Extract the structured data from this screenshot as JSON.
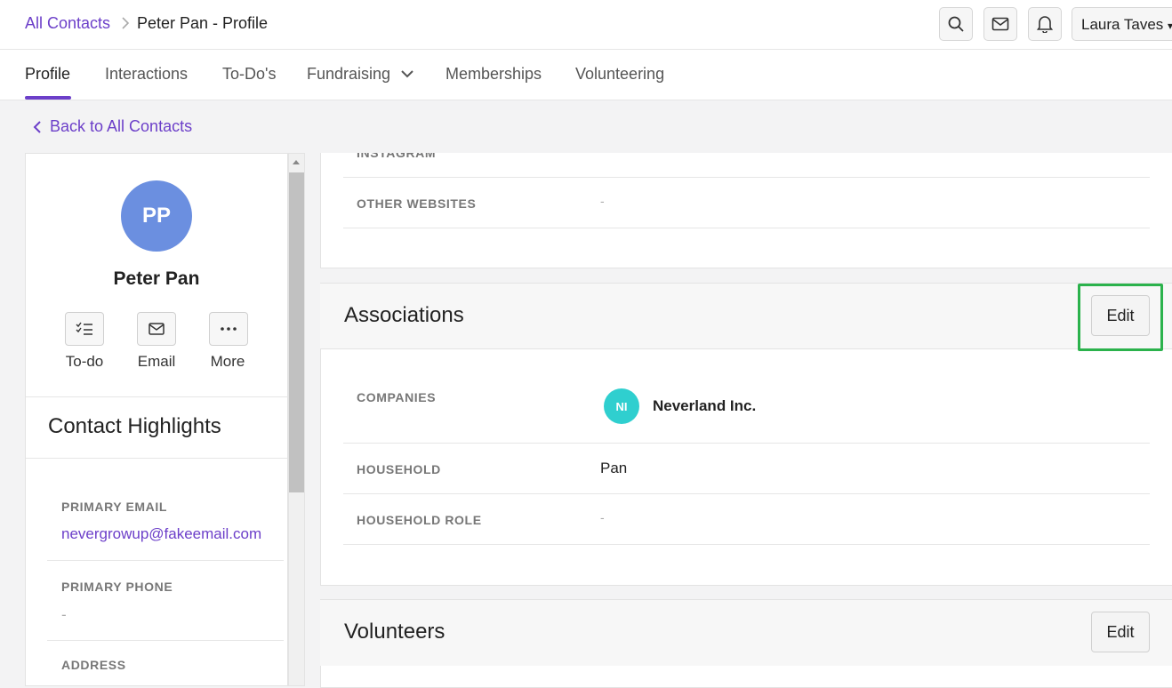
{
  "breadcrumb": {
    "link": "All Contacts",
    "current": "Peter Pan - Profile"
  },
  "header": {
    "user_name": "Laura Taves"
  },
  "tabs": [
    {
      "label": "Profile"
    },
    {
      "label": "Interactions"
    },
    {
      "label": "To-Do's"
    },
    {
      "label": "Fundraising"
    },
    {
      "label": "Memberships"
    },
    {
      "label": "Volunteering"
    }
  ],
  "back_link": "Back to All Contacts",
  "contact": {
    "initials": "PP",
    "name": "Peter Pan",
    "actions": [
      {
        "label": "To-do"
      },
      {
        "label": "Email"
      },
      {
        "label": "More"
      }
    ]
  },
  "highlights": {
    "title": "Contact Highlights",
    "primary_email_label": "PRIMARY EMAIL",
    "primary_email": "nevergrowup@fakeemail.com",
    "primary_phone_label": "PRIMARY PHONE",
    "primary_phone": "-",
    "address_label": "ADDRESS"
  },
  "social": {
    "instagram_label": "INSTAGRAM",
    "instagram_value": "-",
    "other_websites_label": "OTHER WEBSITES",
    "other_websites_value": "-"
  },
  "associations": {
    "title": "Associations",
    "edit_label": "Edit",
    "companies_label": "COMPANIES",
    "company_initials": "NI",
    "company_name": "Neverland Inc.",
    "household_label": "HOUSEHOLD",
    "household_value": "Pan",
    "household_role_label": "HOUSEHOLD ROLE",
    "household_role_value": "-"
  },
  "volunteers": {
    "title": "Volunteers",
    "edit_label": "Edit"
  },
  "colors": {
    "accent": "#6c3fc9",
    "avatar": "#6b8fe0",
    "company_avatar": "#2fcfcf",
    "highlight_box": "#2bb24c"
  }
}
